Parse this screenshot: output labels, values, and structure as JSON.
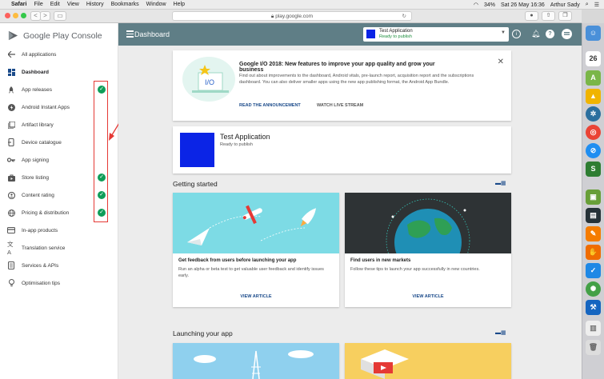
{
  "menubar": {
    "apple": "",
    "items": [
      "Safari",
      "File",
      "Edit",
      "View",
      "History",
      "Bookmarks",
      "Window",
      "Help"
    ],
    "battery": "34%",
    "datetime": "Sat 26 May 16:36",
    "user": "Arthur Sady"
  },
  "browser": {
    "url": "play.google.com",
    "back": "<",
    "forward": ">"
  },
  "sidebar": {
    "logo_text": "Google Play Console",
    "items": [
      {
        "label": "All applications",
        "icon": "arrow-left-icon"
      },
      {
        "label": "Dashboard",
        "icon": "dashboard-icon"
      },
      {
        "label": "App releases",
        "icon": "rocket-icon"
      },
      {
        "label": "Android Instant Apps",
        "icon": "lightning-icon"
      },
      {
        "label": "Artifact library",
        "icon": "library-icon"
      },
      {
        "label": "Device catalogue",
        "icon": "device-icon"
      },
      {
        "label": "App signing",
        "icon": "key-icon"
      },
      {
        "label": "Store listing",
        "icon": "store-icon"
      },
      {
        "label": "Content rating",
        "icon": "rating-icon"
      },
      {
        "label": "Pricing & distribution",
        "icon": "globe-icon"
      },
      {
        "label": "In-app products",
        "icon": "card-icon"
      },
      {
        "label": "Translation service",
        "icon": "translate-icon"
      },
      {
        "label": "Services & APIs",
        "icon": "api-icon"
      },
      {
        "label": "Optimisation tips",
        "icon": "bulb-icon"
      }
    ]
  },
  "header": {
    "title": "Dashboard",
    "app_name": "Test Application",
    "app_status": "Ready to publish"
  },
  "announcement": {
    "title": "Google I/O 2018: New features to improve your app quality and grow your business",
    "text": "Find out about improvements to the dashboard, Android vitals, pre-launch report, acquisition report and the subscriptions dashboard. You can also deliver smaller apps using the new app publishing format, the Android App Bundle.",
    "link1": "READ THE ANNOUNCEMENT",
    "link2": "WATCH LIVE STREAM",
    "close": "✕"
  },
  "app_card": {
    "name": "Test Application",
    "status": "Ready to publish"
  },
  "getting_started": {
    "title": "Getting started",
    "articles": [
      {
        "title": "Get feedback from users before launching your app",
        "text": "Run an alpha or beta test to get valuable user feedback and identify issues early.",
        "link": "VIEW ARTICLE"
      },
      {
        "title": "Find users in new markets",
        "text": "Follow these tips to launch your app successfully in new countries.",
        "link": "VIEW ARTICLE"
      }
    ]
  },
  "launching": {
    "title": "Launching your app"
  },
  "colors": {
    "header": "#5f7e86",
    "accent_blue": "#0b24e6",
    "check_green": "#0f9d58",
    "highlight_red": "#e53935"
  }
}
